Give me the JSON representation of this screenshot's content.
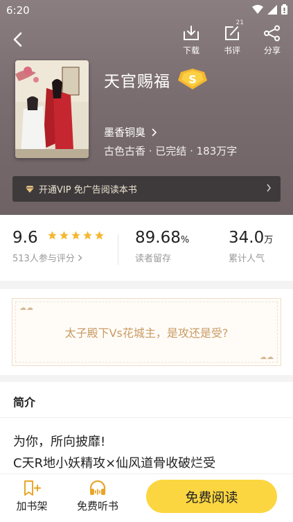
{
  "status": {
    "time": "6:20"
  },
  "toolbar": {
    "download_label": "下载",
    "review_label": "书评",
    "review_count": "21",
    "share_label": "分享"
  },
  "book": {
    "title": "天官赐福",
    "rank_badge": "S",
    "author": "墨香铜臭",
    "meta": "古色古香 · 已完结 · 183万字"
  },
  "vip": {
    "text": "开通VIP 免广告阅读本书"
  },
  "stats": {
    "score": "9.6",
    "score_label": "513人参与评分",
    "stars": 5,
    "retention": "89.68",
    "retention_unit": "%",
    "retention_label": "读者留存",
    "popularity": "34.0",
    "popularity_unit": "万",
    "popularity_label": "累计人气"
  },
  "question": {
    "text": "太子殿下Vs花城主，是攻还是受?"
  },
  "intro": {
    "title": "简介",
    "lines": [
      "为你，所向披靡!",
      "C天R地小妖精攻×仙风道骨收破烂受"
    ]
  },
  "bottom": {
    "shelf_label": "加书架",
    "listen_label": "免费听书",
    "read_label": "免费阅读"
  },
  "colors": {
    "accent": "#fbd640",
    "question_text": "#c99a62",
    "badge": "#f5b731"
  },
  "icons": [
    "arrow-left-icon",
    "download-icon",
    "edit-icon",
    "share-icon",
    "wifi-icon",
    "signal-icon",
    "battery-icon",
    "diamond-icon",
    "chevron-right-icon",
    "star-icon",
    "add-bookmark-icon",
    "headphones-icon"
  ]
}
